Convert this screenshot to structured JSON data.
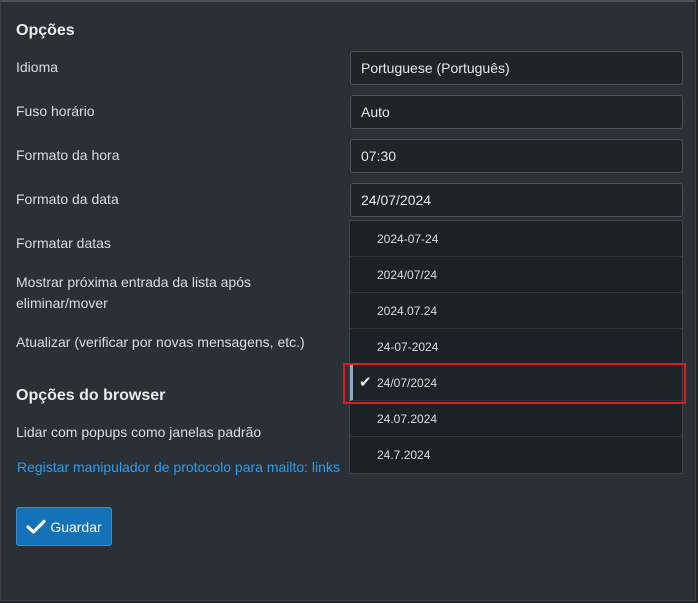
{
  "sections": {
    "options_title": "Opções",
    "browser_title": "Opções do browser"
  },
  "rows": {
    "language_label": "Idioma",
    "language_value": "Portuguese (Português)",
    "timezone_label": "Fuso horário",
    "timezone_value": "Auto",
    "time_format_label": "Formato da hora",
    "time_format_value": "07:30",
    "date_format_label": "Formato da data",
    "date_format_value": "24/07/2024",
    "format_dates_label": "Formatar datas",
    "show_next_label_line1": "Mostrar próxima entrada da lista após",
    "show_next_label_line2": "eliminar/mover",
    "refresh_label": "Atualizar (verificar por novas mensagens, etc.)",
    "popups_label": "Lidar com popups como janelas padrão"
  },
  "dropdown": {
    "options": [
      "2024-07-24",
      "2024/07/24",
      "2024.07.24",
      "24-07-2024",
      "24/07/2024",
      "24.07.2024",
      "24.7.2024"
    ],
    "selected": "24/07/2024"
  },
  "link": {
    "protocol_handler": "Registar manipulador de protocolo para mailto: links"
  },
  "buttons": {
    "save_label": "Guardar"
  },
  "icons": {
    "check": "check-icon"
  }
}
